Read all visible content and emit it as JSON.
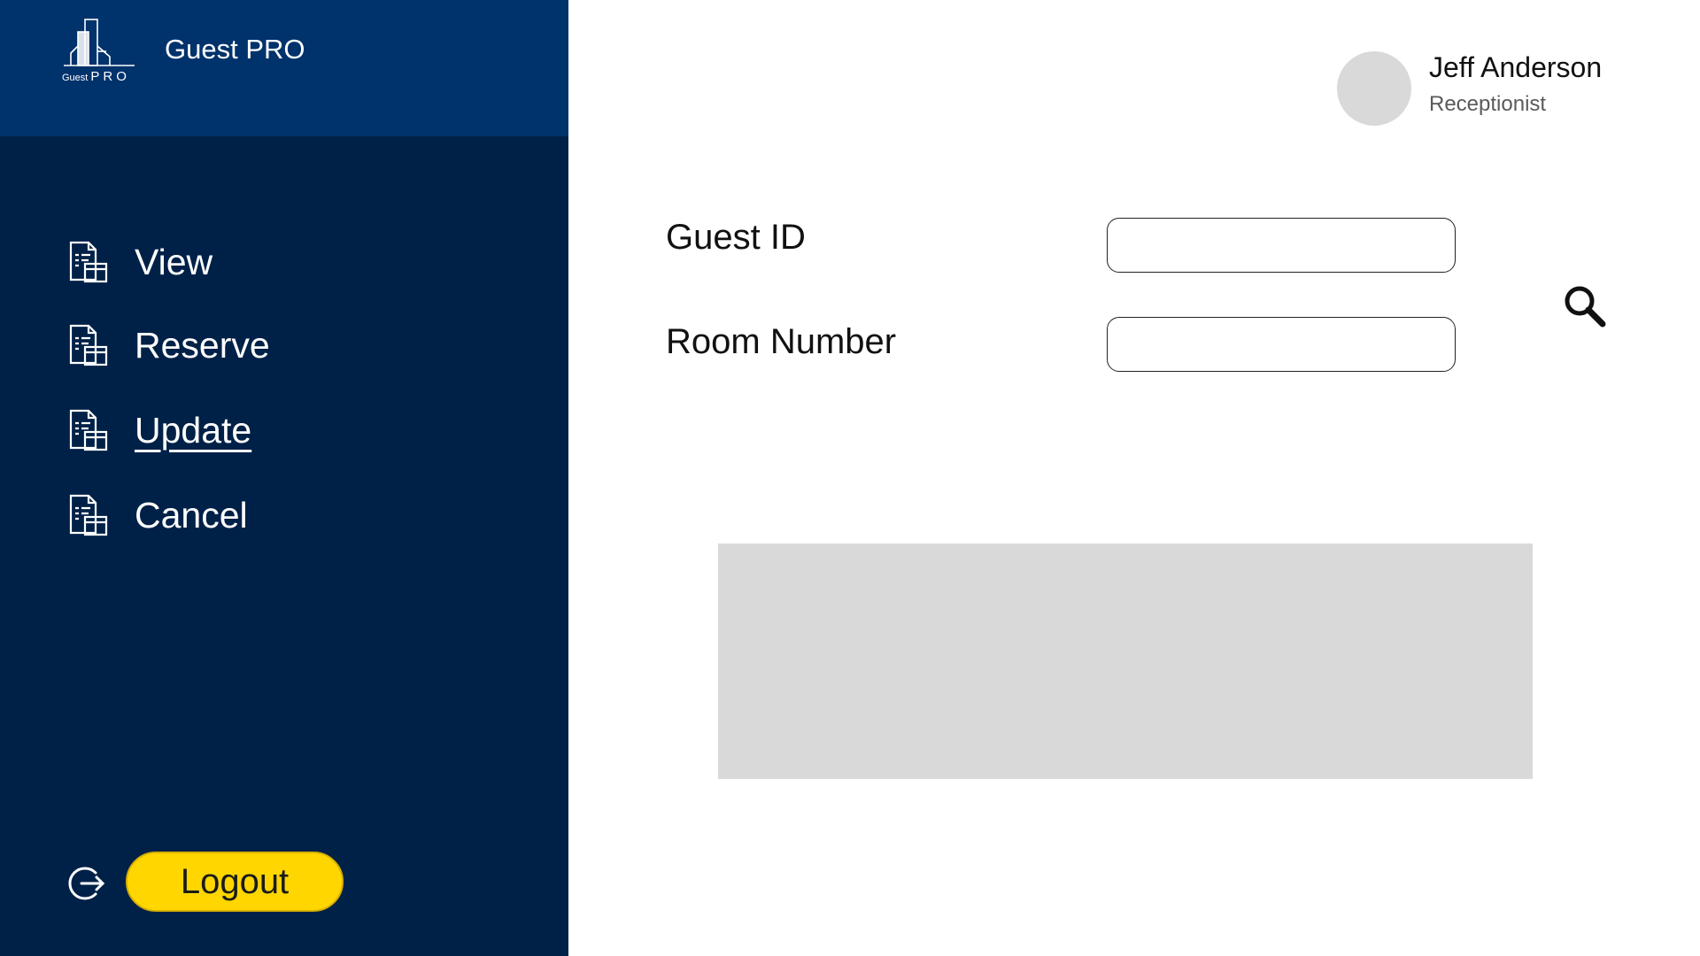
{
  "app": {
    "brand": "Guest PRO",
    "logo_text_small": "Guest",
    "logo_text_pro": "PRO"
  },
  "sidebar": {
    "items": [
      {
        "label": "View",
        "icon": "document-calendar-icon",
        "active": false
      },
      {
        "label": "Reserve",
        "icon": "document-calendar-icon",
        "active": false
      },
      {
        "label": "Update",
        "icon": "document-calendar-icon",
        "active": true
      },
      {
        "label": "Cancel",
        "icon": "document-calendar-icon",
        "active": false
      }
    ],
    "logout_label": "Logout",
    "logout_icon": "logout-icon"
  },
  "user": {
    "name": "Jeff Anderson",
    "role": "Receptionist"
  },
  "form": {
    "guest_id_label": "Guest ID",
    "guest_id_value": "",
    "room_number_label": "Room Number",
    "room_number_value": "",
    "search_icon": "search-icon"
  },
  "colors": {
    "sidebar_bg": "#002147",
    "header_bg": "#00326c",
    "logout_button": "#ffd600",
    "results_panel": "#d9d9d9"
  }
}
